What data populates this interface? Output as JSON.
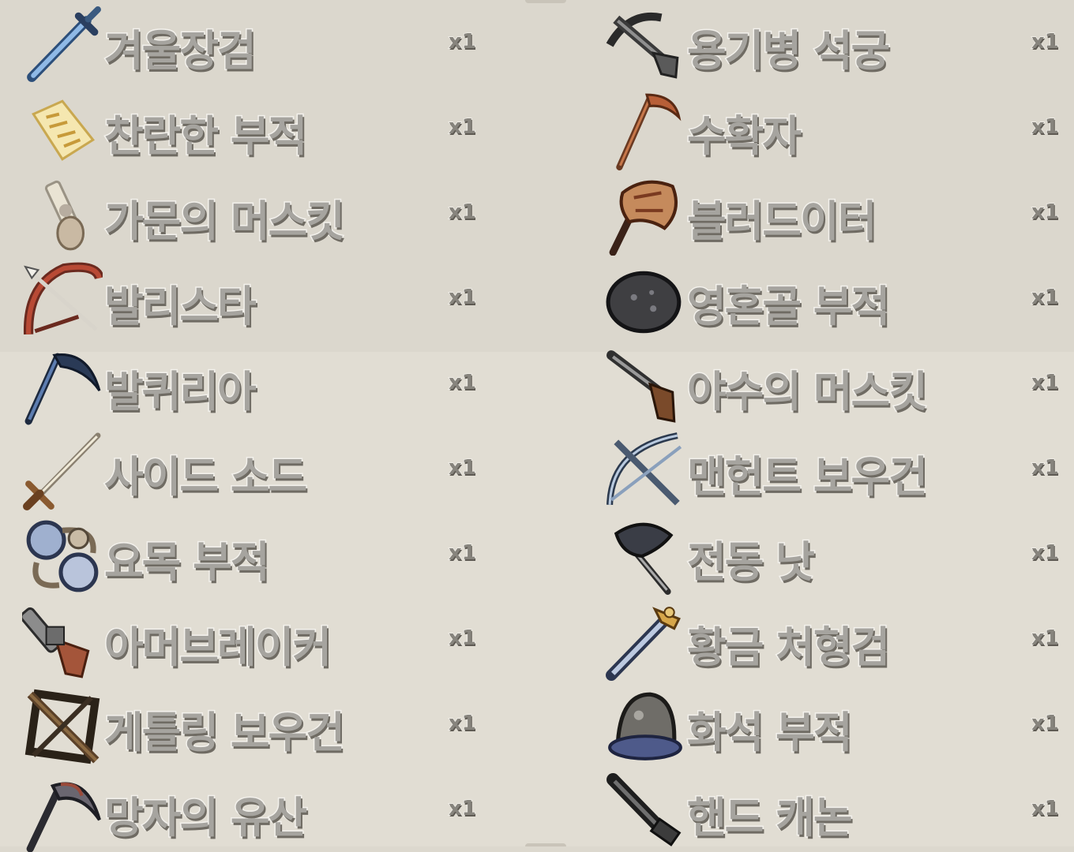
{
  "items_left": [
    {
      "name": "겨울장검",
      "qty": "x1",
      "icon": "winter-longsword-icon"
    },
    {
      "name": "찬란한 부적",
      "qty": "x1",
      "icon": "brilliant-talisman-icon"
    },
    {
      "name": "가문의 머스킷",
      "qty": "x1",
      "icon": "family-musket-icon"
    },
    {
      "name": "발리스타",
      "qty": "x1",
      "icon": "ballista-bow-icon"
    },
    {
      "name": "발퀴리아",
      "qty": "x1",
      "icon": "valkyria-scythe-icon"
    },
    {
      "name": "사이드 소드",
      "qty": "x1",
      "icon": "side-sword-icon"
    },
    {
      "name": "요목 부적",
      "qty": "x1",
      "icon": "yomok-talisman-icon"
    },
    {
      "name": "아머브레이커",
      "qty": "x1",
      "icon": "armorbreaker-pistol-icon"
    },
    {
      "name": "게틀링 보우건",
      "qty": "x1",
      "icon": "gatling-bowgun-icon"
    },
    {
      "name": "망자의 유산",
      "qty": "x1",
      "icon": "dead-legacy-scythe-icon"
    }
  ],
  "items_right": [
    {
      "name": "용기병 석궁",
      "qty": "x1",
      "icon": "dragoon-crossbow-icon"
    },
    {
      "name": "수확자",
      "qty": "x1",
      "icon": "harvester-scythe-icon"
    },
    {
      "name": "블러드이터",
      "qty": "x1",
      "icon": "bloodeater-axe-icon"
    },
    {
      "name": "영혼골 부적",
      "qty": "x1",
      "icon": "soul-bone-talisman-icon"
    },
    {
      "name": "야수의 머스킷",
      "qty": "x1",
      "icon": "beast-musket-icon"
    },
    {
      "name": "맨헌트 보우건",
      "qty": "x1",
      "icon": "manhunt-bowgun-icon"
    },
    {
      "name": "전동 낫",
      "qty": "x1",
      "icon": "electric-sickle-icon"
    },
    {
      "name": "황금 처형검",
      "qty": "x1",
      "icon": "golden-executioner-sword-icon"
    },
    {
      "name": "화석 부적",
      "qty": "x1",
      "icon": "fossil-talisman-icon"
    },
    {
      "name": "핸드 캐논",
      "qty": "x1",
      "icon": "hand-cannon-icon"
    }
  ]
}
